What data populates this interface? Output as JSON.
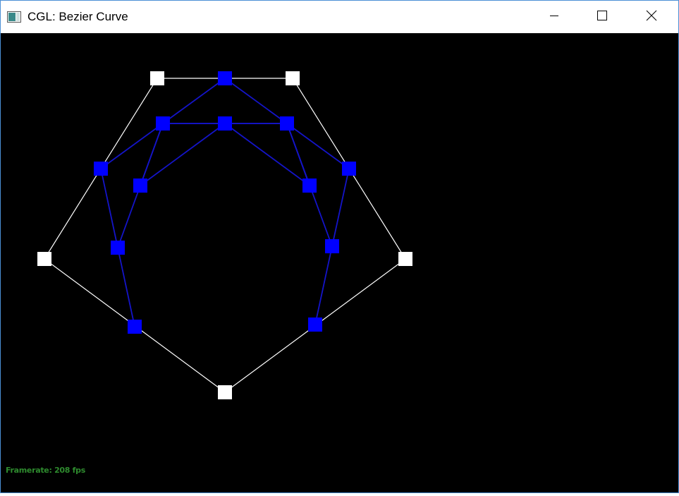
{
  "window": {
    "title": "CGL: Bezier Curve",
    "icon": "app-window-icon"
  },
  "titlebar_buttons": {
    "minimize": "minimize-icon",
    "maximize": "maximize-icon",
    "close": "close-icon"
  },
  "status": {
    "framerate": "Framerate: 208 fps"
  },
  "colors": {
    "background": "#000000",
    "control_polygon": "#ffffff",
    "intermediate": "#0000ff",
    "intermediate_line": "#1414c8",
    "framerate_text": "#2e8b2e"
  },
  "scene": {
    "control_points": 7,
    "intermediate_levels": 2
  }
}
